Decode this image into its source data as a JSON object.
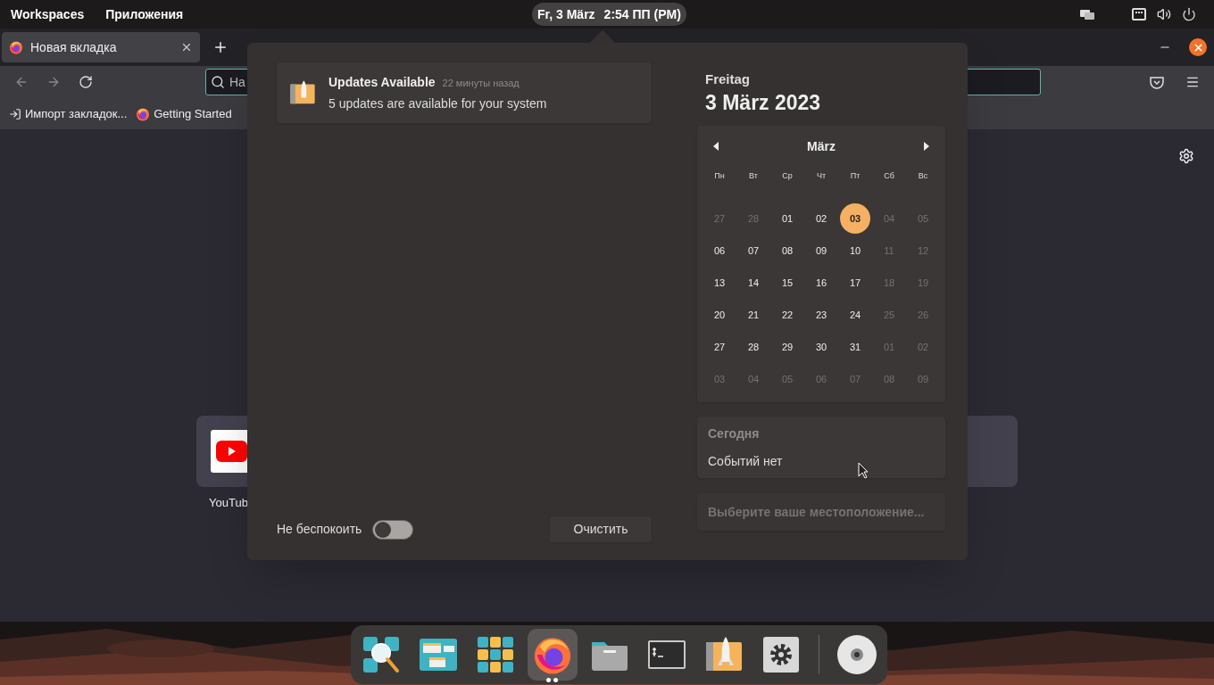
{
  "top_bar": {
    "menus": [
      "Workspaces",
      "Приложения"
    ],
    "clock": {
      "date": "Fr, 3 März",
      "time": "2:54 ПП (PM)"
    }
  },
  "browser": {
    "tab": {
      "title": "Новая вкладка"
    },
    "url_placeholder": "На",
    "bookmarks": [
      {
        "kind": "import",
        "label": "Импорт закладок..."
      },
      {
        "kind": "firefox",
        "label": "Getting Started"
      }
    ],
    "shortcuts": [
      {
        "label": "YouTub"
      }
    ]
  },
  "notifications": [
    {
      "title": "Updates Available",
      "time": "22 минуты назад",
      "body": "5 updates are available for your system"
    }
  ],
  "do_not_disturb": {
    "label": "Не беспокоить",
    "on": false
  },
  "clear_button": "Очистить",
  "date": {
    "weekday": "Freitag",
    "full": "3 März 2023"
  },
  "calendar": {
    "month": "März",
    "weekdays": [
      "Пн",
      "Вт",
      "Ср",
      "Чт",
      "Пт",
      "Сб",
      "Вс"
    ],
    "days": [
      {
        "text": "27",
        "muted": true,
        "selected": false
      },
      {
        "text": "28",
        "muted": true,
        "selected": false
      },
      {
        "text": "01",
        "muted": false,
        "selected": false
      },
      {
        "text": "02",
        "muted": false,
        "selected": false
      },
      {
        "text": "03",
        "muted": false,
        "selected": true
      },
      {
        "text": "04",
        "muted": true,
        "selected": false
      },
      {
        "text": "05",
        "muted": true,
        "selected": false
      },
      {
        "text": "06",
        "muted": false,
        "selected": false
      },
      {
        "text": "07",
        "muted": false,
        "selected": false
      },
      {
        "text": "08",
        "muted": false,
        "selected": false
      },
      {
        "text": "09",
        "muted": false,
        "selected": false
      },
      {
        "text": "10",
        "muted": false,
        "selected": false
      },
      {
        "text": "11",
        "muted": true,
        "selected": false
      },
      {
        "text": "12",
        "muted": true,
        "selected": false
      },
      {
        "text": "13",
        "muted": false,
        "selected": false
      },
      {
        "text": "14",
        "muted": false,
        "selected": false
      },
      {
        "text": "15",
        "muted": false,
        "selected": false
      },
      {
        "text": "16",
        "muted": false,
        "selected": false
      },
      {
        "text": "17",
        "muted": false,
        "selected": false
      },
      {
        "text": "18",
        "muted": true,
        "selected": false
      },
      {
        "text": "19",
        "muted": true,
        "selected": false
      },
      {
        "text": "20",
        "muted": false,
        "selected": false
      },
      {
        "text": "21",
        "muted": false,
        "selected": false
      },
      {
        "text": "22",
        "muted": false,
        "selected": false
      },
      {
        "text": "23",
        "muted": false,
        "selected": false
      },
      {
        "text": "24",
        "muted": false,
        "selected": false
      },
      {
        "text": "25",
        "muted": true,
        "selected": false
      },
      {
        "text": "26",
        "muted": true,
        "selected": false
      },
      {
        "text": "27",
        "muted": false,
        "selected": false
      },
      {
        "text": "28",
        "muted": false,
        "selected": false
      },
      {
        "text": "29",
        "muted": false,
        "selected": false
      },
      {
        "text": "30",
        "muted": false,
        "selected": false
      },
      {
        "text": "31",
        "muted": false,
        "selected": false
      },
      {
        "text": "01",
        "muted": true,
        "selected": false
      },
      {
        "text": "02",
        "muted": true,
        "selected": false
      },
      {
        "text": "03",
        "muted": true,
        "selected": false
      },
      {
        "text": "04",
        "muted": true,
        "selected": false
      },
      {
        "text": "05",
        "muted": true,
        "selected": false
      },
      {
        "text": "06",
        "muted": true,
        "selected": false
      },
      {
        "text": "07",
        "muted": true,
        "selected": false
      },
      {
        "text": "08",
        "muted": true,
        "selected": false
      },
      {
        "text": "09",
        "muted": true,
        "selected": false
      }
    ]
  },
  "today": {
    "title": "Сегодня",
    "body": "Событий нет"
  },
  "location": "Выберите ваше местоположение...",
  "dock": [
    {
      "kind": "search",
      "selected": false,
      "running": false
    },
    {
      "kind": "windows",
      "selected": false,
      "running": false
    },
    {
      "kind": "apps",
      "selected": false,
      "running": false
    },
    {
      "kind": "firefox",
      "selected": true,
      "running": true
    },
    {
      "kind": "files",
      "selected": false,
      "running": false
    },
    {
      "kind": "terminal",
      "selected": false,
      "running": false
    },
    {
      "kind": "updater",
      "selected": false,
      "running": false
    },
    {
      "kind": "settings",
      "selected": false,
      "running": false
    },
    {
      "kind": "separator"
    },
    {
      "kind": "disc",
      "selected": false,
      "running": false
    }
  ]
}
